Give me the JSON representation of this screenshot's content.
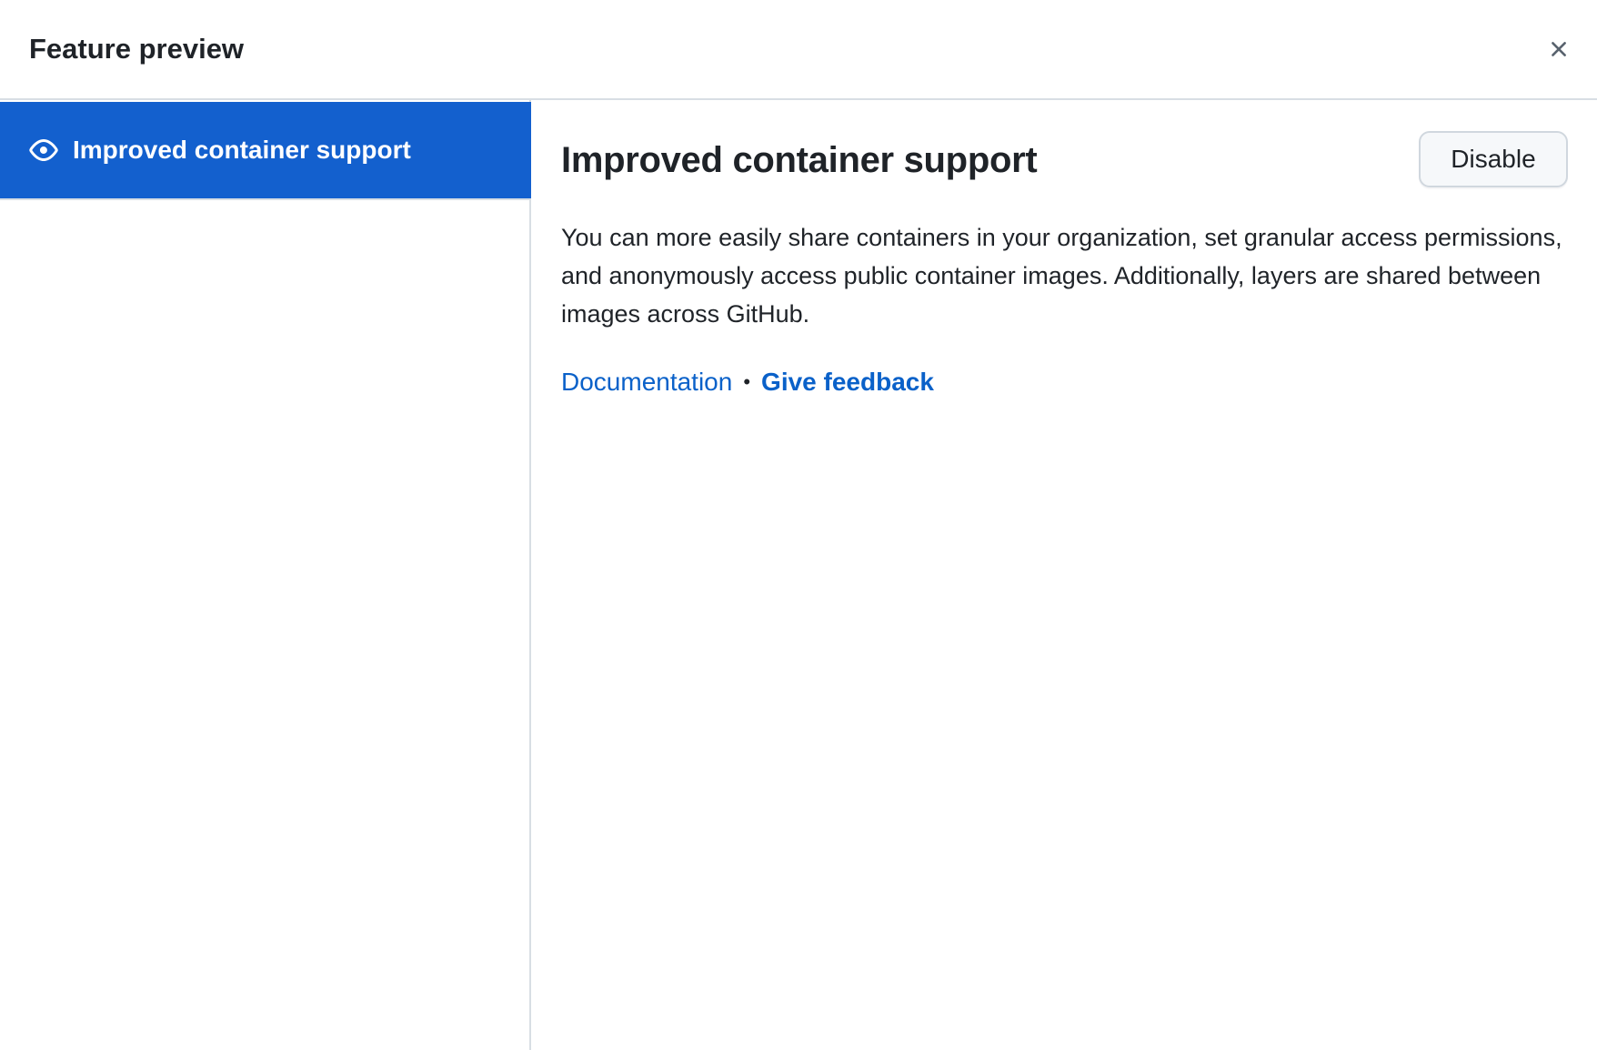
{
  "dialog": {
    "title": "Feature preview",
    "close_icon": "close-icon"
  },
  "sidebar": {
    "items": [
      {
        "label": "Improved container support",
        "icon": "eye-icon",
        "selected": true
      }
    ]
  },
  "content": {
    "title": "Improved container support",
    "disable_label": "Disable",
    "description": "You can more easily share containers in your organization, set granular access permissions, and anonymously access public container images. Additionally, layers are shared between images across GitHub.",
    "links": {
      "documentation": "Documentation",
      "separator": "•",
      "feedback": "Give feedback"
    }
  },
  "colors": {
    "accent": "#1360ce",
    "link": "#0a61c9",
    "border": "#d8dee4",
    "text": "#1f2328",
    "button_bg": "#f6f8fa"
  }
}
